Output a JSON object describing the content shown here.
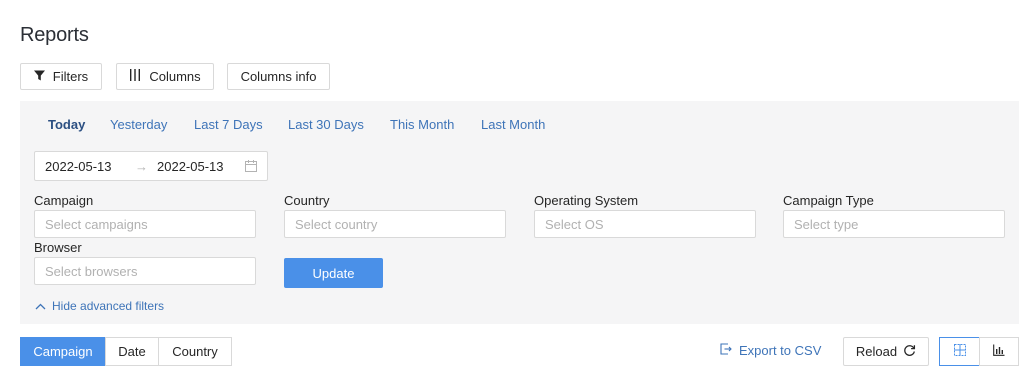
{
  "page": {
    "title": "Reports"
  },
  "toolbar": {
    "filters": "Filters",
    "columns": "Columns",
    "columns_info": "Columns info"
  },
  "presets": [
    "Today",
    "Yesterday",
    "Last 7 Days",
    "Last 30 Days",
    "This Month",
    "Last Month"
  ],
  "active_preset": "Today",
  "date_range": {
    "start": "2022-05-13",
    "separator": "→",
    "end": "2022-05-13"
  },
  "filters": {
    "campaign": {
      "label": "Campaign",
      "placeholder": "Select campaigns"
    },
    "country": {
      "label": "Country",
      "placeholder": "Select country"
    },
    "os": {
      "label": "Operating System",
      "placeholder": "Select OS"
    },
    "campaign_type": {
      "label": "Campaign Type",
      "placeholder": "Select type"
    },
    "browser": {
      "label": "Browser",
      "placeholder": "Select browsers"
    }
  },
  "update_label": "Update",
  "hide_advanced_label": "Hide advanced filters",
  "group_by": {
    "options": [
      "Campaign",
      "Date",
      "Country"
    ],
    "selected": "Campaign"
  },
  "export_label": "Export to CSV",
  "reload_label": "Reload",
  "view": {
    "selected": "table"
  },
  "colors": {
    "accent": "#4a90e8",
    "link": "#3e74b8",
    "panel_bg": "#f5f5f6",
    "border": "#d9d9d9"
  }
}
